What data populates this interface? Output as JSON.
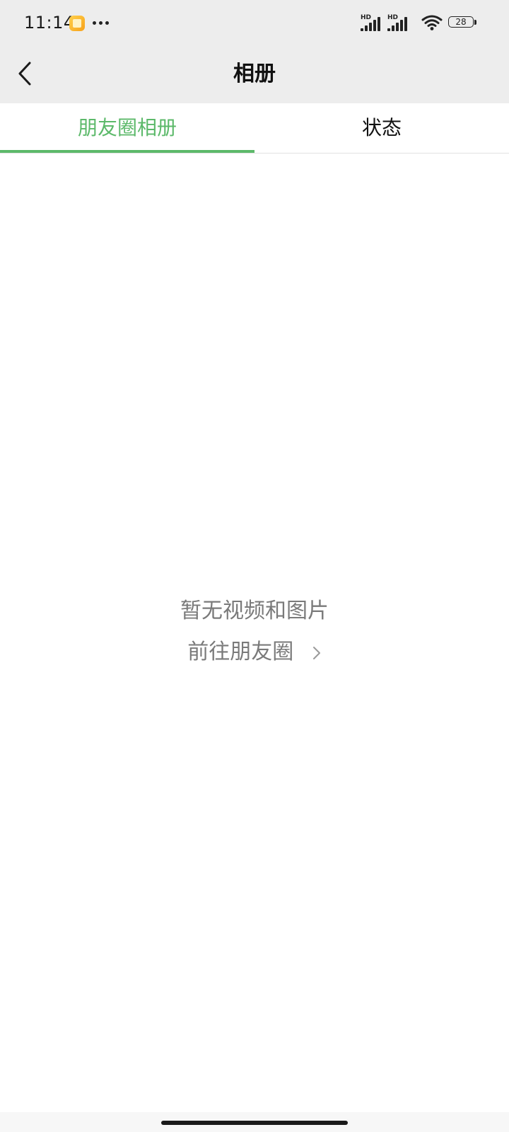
{
  "status_bar": {
    "time": "11:14",
    "notification_icon": "app-notification-icon",
    "more_icon": "more-dots-icon",
    "sim1_label": "HD",
    "sim2_label": "HD",
    "wifi_icon": "wifi-icon",
    "battery_level": "28"
  },
  "nav": {
    "back_icon": "chevron-left-icon",
    "title": "相册"
  },
  "tabs": [
    {
      "label": "朋友圈相册",
      "active": true
    },
    {
      "label": "状态",
      "active": false
    }
  ],
  "empty_state": {
    "message": "暂无视频和图片",
    "link_label": "前往朋友圈",
    "link_icon": "chevron-right-icon"
  },
  "colors": {
    "accent": "#5cb96a",
    "header_bg": "#ededed",
    "muted_text": "#7a7a7a"
  }
}
